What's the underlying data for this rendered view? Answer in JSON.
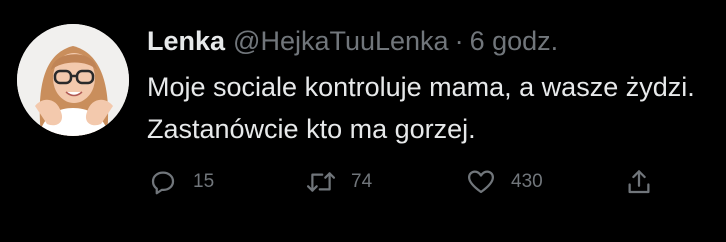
{
  "author": {
    "name": "Lenka",
    "handle": "@HejkaTuuLenka",
    "separator": "·",
    "timestamp": "6 godz."
  },
  "tweet": {
    "text": "Moje sociale kontroluje mama, a wasze żydzi. Zastanówcie kto ma gorzej."
  },
  "actions": {
    "reply": {
      "icon": "reply-icon",
      "count": "15"
    },
    "retweet": {
      "icon": "retweet-icon",
      "count": "74"
    },
    "like": {
      "icon": "heart-icon",
      "count": "430"
    },
    "share": {
      "icon": "share-icon"
    }
  },
  "colors": {
    "background": "#000000",
    "primary_text": "#e7e9ea",
    "secondary_text": "#71767b"
  }
}
